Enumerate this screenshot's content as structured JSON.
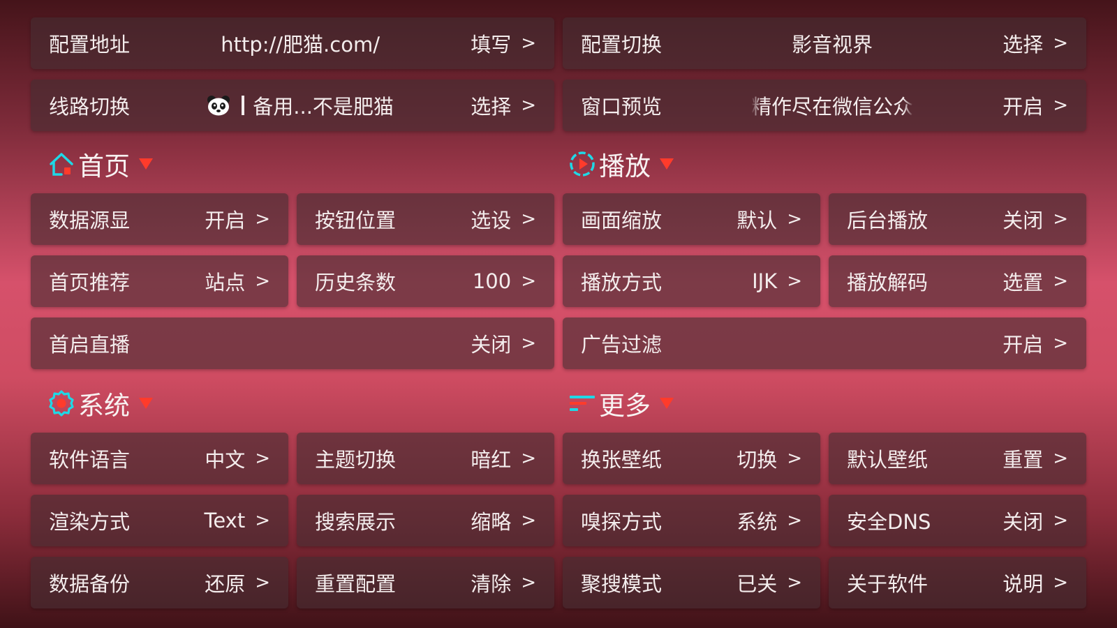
{
  "top_rows": [
    [
      {
        "label": "配置地址",
        "middle": "http://肥猫.com/",
        "value": "填写",
        "arrow": ">"
      },
      {
        "label": "配置切换",
        "middle": "影音视界",
        "value": "选择",
        "arrow": ">"
      }
    ],
    [
      {
        "label": "线路切换",
        "middle_icon": "panda-icon",
        "middle": "备用...不是肥猫",
        "value": "选择",
        "arrow": ">"
      },
      {
        "label": "窗口预览",
        "middle": "精作尽在微信公众",
        "value": "开启",
        "arrow": ">"
      }
    ]
  ],
  "sections": {
    "home": {
      "title": "首页",
      "icon": "home-icon"
    },
    "play": {
      "title": "播放",
      "icon": "play-circle-icon"
    },
    "system": {
      "title": "系统",
      "icon": "gear-icon"
    },
    "more": {
      "title": "更多",
      "icon": "menu-lines-icon"
    }
  },
  "home_items": [
    {
      "label": "数据源显",
      "value": "开启",
      "arrow": ">"
    },
    {
      "label": "按钮位置",
      "value": "选设",
      "arrow": ">"
    },
    {
      "label": "首页推荐",
      "value": "站点",
      "arrow": ">"
    },
    {
      "label": "历史条数",
      "value": "100",
      "arrow": ">"
    },
    {
      "label": "首启直播",
      "value": "关闭",
      "arrow": ">"
    }
  ],
  "play_items": [
    {
      "label": "画面缩放",
      "value": "默认",
      "arrow": ">"
    },
    {
      "label": "后台播放",
      "value": "关闭",
      "arrow": ">"
    },
    {
      "label": "播放方式",
      "value": "IJK",
      "arrow": ">"
    },
    {
      "label": "播放解码",
      "value": "选置",
      "arrow": ">"
    },
    {
      "label": "广告过滤",
      "value": "开启",
      "arrow": ">"
    }
  ],
  "system_items": [
    {
      "label": "软件语言",
      "value": "中文",
      "arrow": ">"
    },
    {
      "label": "主题切换",
      "value": "暗红",
      "arrow": ">"
    },
    {
      "label": "渲染方式",
      "value": "Text",
      "arrow": ">"
    },
    {
      "label": "搜索展示",
      "value": "缩略",
      "arrow": ">"
    },
    {
      "label": "数据备份",
      "value": "还原",
      "arrow": ">"
    },
    {
      "label": "重置配置",
      "value": "清除",
      "arrow": ">"
    }
  ],
  "more_items": [
    {
      "label": "换张壁纸",
      "value": "切换",
      "arrow": ">"
    },
    {
      "label": "默认壁纸",
      "value": "重置",
      "arrow": ">"
    },
    {
      "label": "嗅探方式",
      "value": "系统",
      "arrow": ">"
    },
    {
      "label": "安全DNS",
      "value": "关闭",
      "arrow": ">"
    },
    {
      "label": "聚搜模式",
      "value": "已关",
      "arrow": ">"
    },
    {
      "label": "关于软件",
      "value": "说明",
      "arrow": ">"
    }
  ],
  "colors": {
    "accent_cyan": "#1fd8e6",
    "accent_red": "#ff3b2b",
    "card_bg": "rgba(70,45,50,0.62)"
  }
}
